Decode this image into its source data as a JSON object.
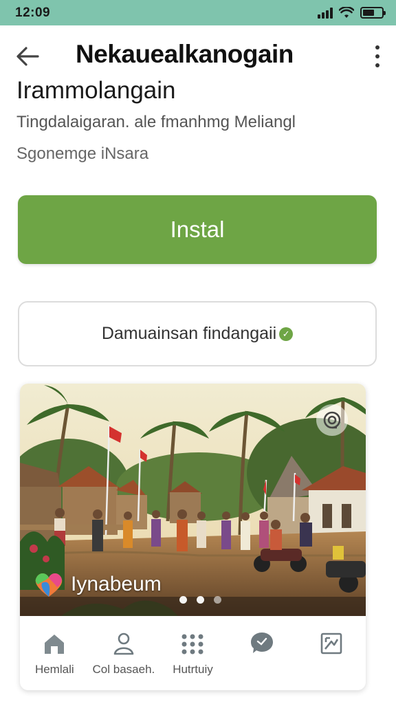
{
  "status_bar": {
    "time": "12:09"
  },
  "header": {
    "title": "Nekauealkanogain"
  },
  "app": {
    "name": "Irammolangain",
    "subtitle": "Tingdalaigaran. ale fmanhmg Meliangl",
    "category": "Sgonemge iNsara"
  },
  "install_button": {
    "label": "Instal"
  },
  "secondary_button": {
    "label": "Damuainsan findangaii"
  },
  "carousel": {
    "caption": "Iynabeum",
    "dots": 3,
    "active_dot": 0
  },
  "bottom_nav": {
    "items": [
      {
        "label": "Hemlali",
        "icon": "home-icon"
      },
      {
        "label": "Col basaeh.",
        "icon": "person-icon"
      },
      {
        "label": "Hutrtuiy",
        "icon": "grid-dots-icon"
      },
      {
        "label": "",
        "icon": "chat-bubble-icon"
      },
      {
        "label": "",
        "icon": "image-frame-icon"
      }
    ]
  },
  "colors": {
    "status_bar": "#7fc4ad",
    "install_button": "#6ea545",
    "text_primary": "#1a1a1a",
    "text_secondary": "#555555"
  }
}
